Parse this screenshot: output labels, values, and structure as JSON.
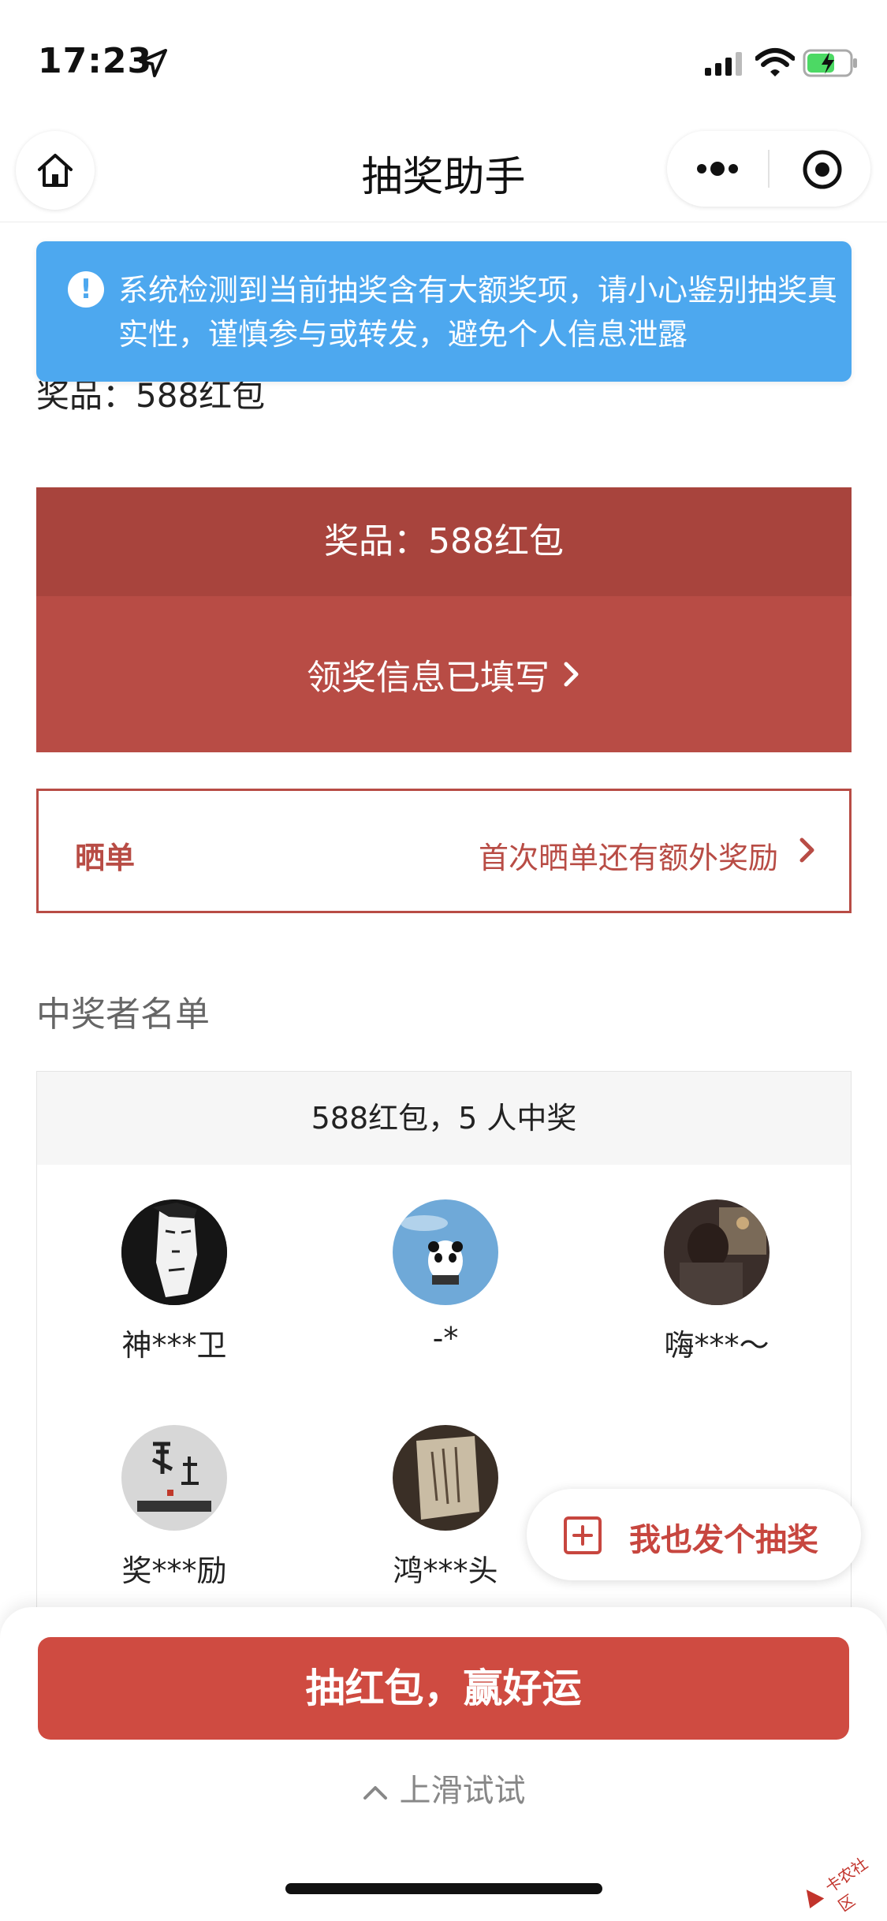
{
  "status_bar": {
    "time": "17:23"
  },
  "nav": {
    "title": "抽奖助手"
  },
  "warning": {
    "text": "系统检测到当前抽奖含有大额奖项，请小心鉴别抽奖真实性，谨慎参与或转发，避免个人信息泄露"
  },
  "prize": {
    "background_text": "奖品：588红包",
    "title": "奖品：588红包",
    "claim_status": "领奖信息已填写"
  },
  "share": {
    "label": "晒单",
    "hint": "首次晒单还有额外奖励"
  },
  "winners": {
    "title": "中奖者名单",
    "summary": "588红包，5 人中奖",
    "list": [
      {
        "name": "神***卫"
      },
      {
        "name": "-*"
      },
      {
        "name": "嗨***～"
      },
      {
        "name": "奖***励"
      },
      {
        "name": "鸿***头"
      }
    ]
  },
  "floating": {
    "create_label": "我也发个抽奖"
  },
  "bottom": {
    "draw_label": "抽红包，赢好运",
    "swipe_hint": "上滑试试"
  },
  "watermark": {
    "text": "卡农社区"
  },
  "colors": {
    "accent_red": "#cf4b41",
    "prize_dark": "#a8443d",
    "warning_blue": "#4da8ef"
  }
}
